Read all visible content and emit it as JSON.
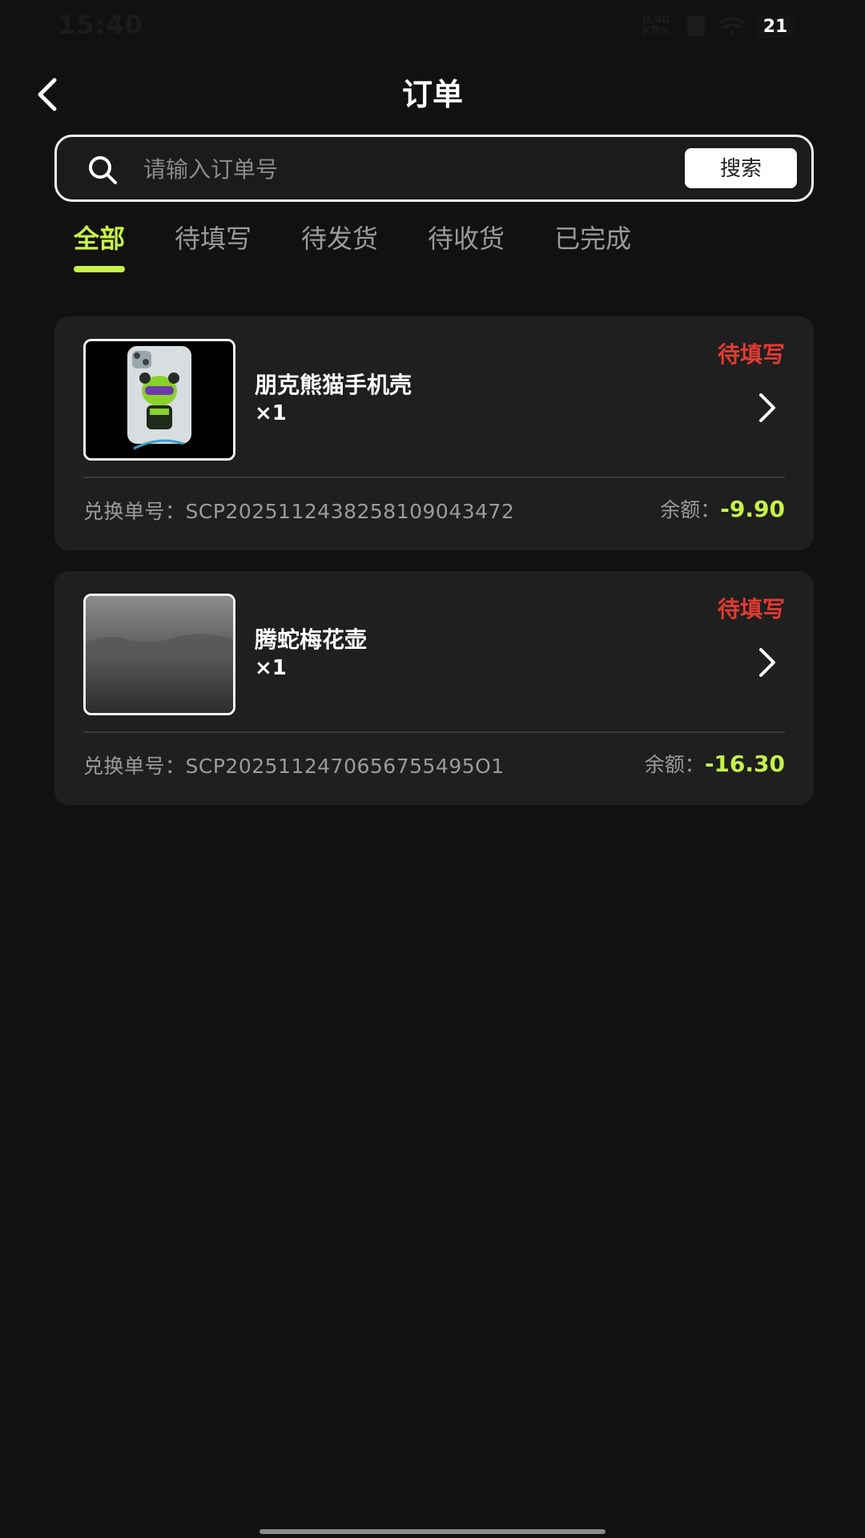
{
  "status_bar": {
    "time": "15:40",
    "network": "0.40 KB/s",
    "battery": "21"
  },
  "header": {
    "title": "订单",
    "back_icon": "chevron-left-icon"
  },
  "search": {
    "placeholder": "请输入订单号",
    "value": "",
    "button_label": "搜索",
    "icon": "search-icon"
  },
  "tabs": [
    {
      "label": "全部",
      "active": true
    },
    {
      "label": "待填写",
      "active": false
    },
    {
      "label": "待发货",
      "active": false
    },
    {
      "label": "待收货",
      "active": false
    },
    {
      "label": "已完成",
      "active": false
    }
  ],
  "orders": [
    {
      "name": "朋克熊猫手机壳",
      "quantity": "×1",
      "status": "待填写",
      "number_label": "兑换单号：",
      "number": "SCP2025112438258109043472",
      "balance_label": "余额：",
      "balance": "-9.90",
      "image": "panda-phone-case"
    },
    {
      "name": "腾蛇梅花壶",
      "quantity": "×1",
      "status": "待填写",
      "number_label": "兑换单号：",
      "number": "SCP2025112470656755495O1",
      "balance_label": "余额：",
      "balance": "-16.30",
      "image": "misty-landscape"
    }
  ],
  "colors": {
    "accent": "#c7f24a",
    "status_red": "#e23a32",
    "background": "#111111",
    "card": "#1e1f1e"
  }
}
